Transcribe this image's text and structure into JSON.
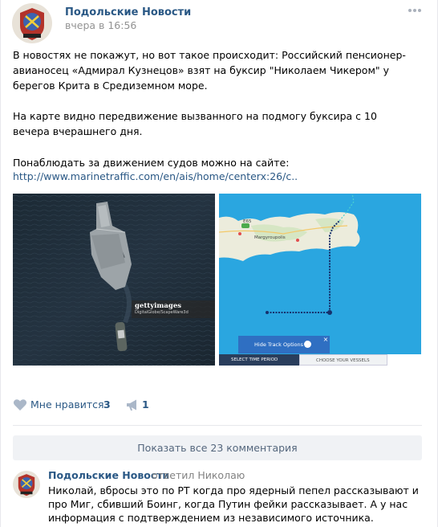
{
  "post": {
    "author": "Подольские Новости",
    "date": "вчера в 16:56",
    "more_icon": "ellipsis-icon",
    "text_p1": "В новостях не покажут, но вот такое происходит: Российский пенсионер-авианосец «Адмирал Кузнецов» взят на буксир \"Николаем Чикером\" у берегов Крита в Средиземном море.",
    "text_p2": "На карте видно передвижение вызванного на подмогу буксира с 10 вечера вчерашнего дня.",
    "text_p3": "Понаблюдать за движением судов можно на сайте:",
    "link": "http://www.marinetraffic.com/en/ais/home/centerx:26/c.."
  },
  "photos": {
    "left": {
      "watermark": "gettyimages",
      "watermark_sub": "DigitalGlobe/ScapeWare3d"
    },
    "right": {
      "place_label": "Margyroupolis",
      "road_label": "E65",
      "track_button": "Hide Track Options",
      "track_close": "×",
      "tab_period": "SELECT TIME PERIOD",
      "tab_vessels": "CHOOSE YOUR VESSELS"
    }
  },
  "actions": {
    "like_label": "Мне нравится",
    "like_count": "3",
    "like_icon": "heart-icon",
    "share_count": "1",
    "share_icon": "megaphone-icon"
  },
  "comments": {
    "show_all": "Показать все 23 комментария",
    "items": [
      {
        "author": "Подольские Новости",
        "reply_to": "ответил Николаю",
        "text": "Николай, вбросы это по РТ когда про ядерный пепел рассказывают и про Миг, сбивший Боинг, когда Путин фейки рассказывает. А у нас информация с подтверждением из независимого источника."
      }
    ]
  },
  "colors": {
    "link": "#2a5885",
    "sea": "#2aa6e0",
    "land": "#ececdc",
    "track": "#16316d",
    "button_bg": "#f0f2f5"
  }
}
